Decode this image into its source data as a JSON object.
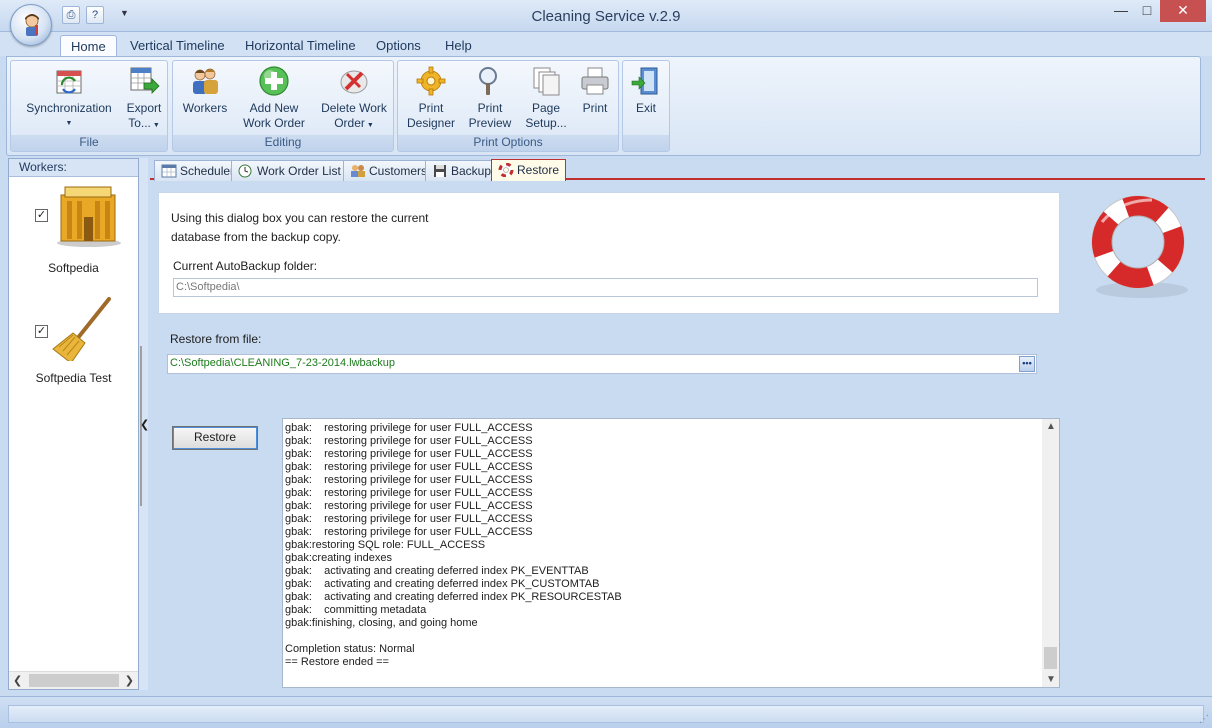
{
  "window": {
    "title": "Cleaning Service v.2.9"
  },
  "ribbon_tabs": [
    "Home",
    "Vertical Timeline",
    "Horizontal Timeline",
    "Options",
    "Help"
  ],
  "ribbon_groups": {
    "file": {
      "label": "File",
      "buttons": [
        {
          "line1": "Synchronization",
          "line2": ""
        },
        {
          "line1": "Export",
          "line2": "To..."
        }
      ]
    },
    "editing": {
      "label": "Editing",
      "buttons": [
        {
          "line1": "Workers",
          "line2": ""
        },
        {
          "line1": "Add New",
          "line2": "Work Order"
        },
        {
          "line1": "Delete Work",
          "line2": "Order"
        }
      ]
    },
    "print_options": {
      "label": "Print Options",
      "buttons": [
        {
          "line1": "Print",
          "line2": "Designer"
        },
        {
          "line1": "Print",
          "line2": "Preview"
        },
        {
          "line1": "Page",
          "line2": "Setup..."
        },
        {
          "line1": "Print",
          "line2": ""
        }
      ]
    },
    "exit": {
      "label": "",
      "buttons": [
        {
          "line1": "Exit",
          "line2": ""
        }
      ]
    }
  },
  "workers_panel": {
    "header": "Workers:",
    "items": [
      {
        "name": "Softpedia",
        "checked": "✓"
      },
      {
        "name": "Softpedia Test",
        "checked": "✓"
      }
    ]
  },
  "content_tabs": [
    "Scheduler",
    "Work Order List",
    "Customers",
    "Backup",
    "Restore"
  ],
  "restore": {
    "info_line1": "Using this dialog box you can restore the current",
    "info_line2": "database from the backup copy.",
    "autobackup_label": "Current AutoBackup folder:",
    "autobackup_value": "C:\\Softpedia\\",
    "restore_from_label": "Restore from file:",
    "restore_file_value": "C:\\Softpedia\\CLEANING_7-23-2014.lwbackup",
    "browse_label": "•••",
    "restore_button": "Restore",
    "log": [
      "gbak:    restoring privilege for user FULL_ACCESS",
      "gbak:    restoring privilege for user FULL_ACCESS",
      "gbak:    restoring privilege for user FULL_ACCESS",
      "gbak:    restoring privilege for user FULL_ACCESS",
      "gbak:    restoring privilege for user FULL_ACCESS",
      "gbak:    restoring privilege for user FULL_ACCESS",
      "gbak:    restoring privilege for user FULL_ACCESS",
      "gbak:    restoring privilege for user FULL_ACCESS",
      "gbak:    restoring privilege for user FULL_ACCESS",
      "gbak:restoring SQL role: FULL_ACCESS",
      "gbak:creating indexes",
      "gbak:    activating and creating deferred index PK_EVENTTAB",
      "gbak:    activating and creating deferred index PK_CUSTOMTAB",
      "gbak:    activating and creating deferred index PK_RESOURCESTAB",
      "gbak:    committing metadata",
      "gbak:finishing, closing, and going home",
      "",
      "Completion status: Normal",
      "== Restore ended =="
    ]
  },
  "colors": {
    "accent_red": "#c03030",
    "ribbon_blue": "#d8e5f5",
    "path_green": "#1d7b1d"
  }
}
